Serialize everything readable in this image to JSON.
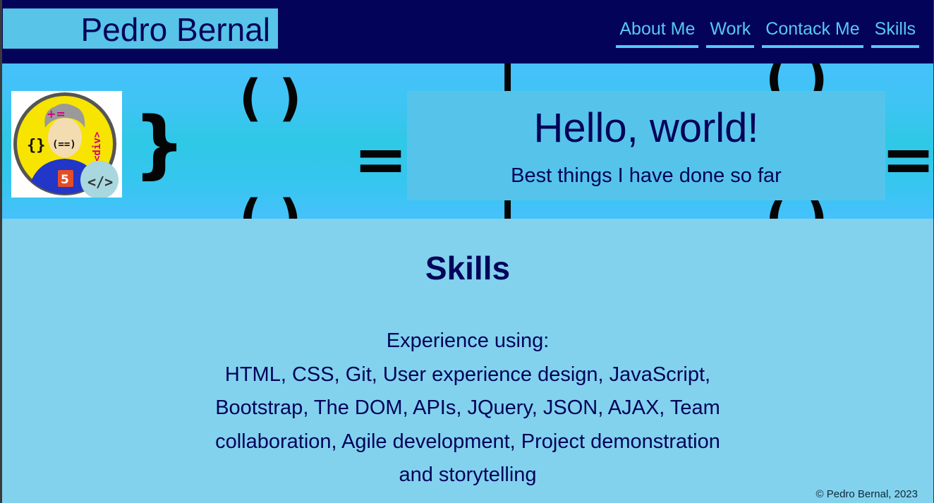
{
  "header": {
    "brand": "Pedro Bernal",
    "nav": [
      "About Me",
      "Work",
      "Contack Me",
      "Skills"
    ]
  },
  "hero": {
    "title": "Hello, world!",
    "subtitle": "Best things I have done so far",
    "avatar_icon": "developer-avatar-icon"
  },
  "skills": {
    "title": "Skills",
    "intro": "Experience using:",
    "list": "HTML, CSS, Git, User experience design, JavaScript, Bootstrap, The DOM, APIs, JQuery, JSON, AJAX, Team collaboration, Agile development, Project demonstration and storytelling"
  },
  "footer": {
    "copyright": "© Pedro Bernal, 2023"
  },
  "colors": {
    "header_bg": "#04035a",
    "brand_bg": "#57c4e8",
    "nav_color": "#58c8f2",
    "hero_bg": "#46c1fb",
    "content_bg": "#82d2ee",
    "text_dark": "#04035a"
  }
}
